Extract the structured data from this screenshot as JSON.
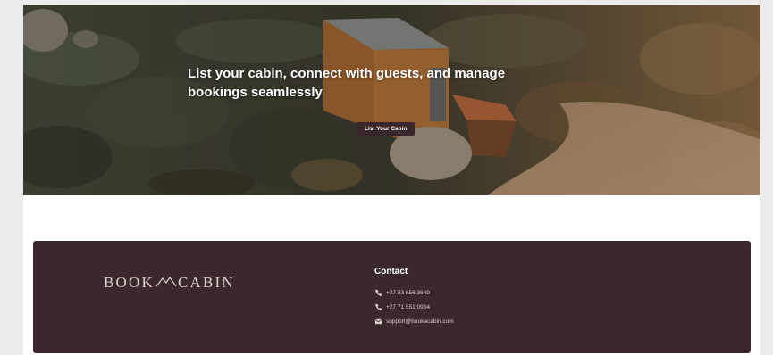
{
  "hero": {
    "headline": "List your cabin, connect with guests, and manage bookings seamlessly",
    "cta_label": "List Your Cabin"
  },
  "footer": {
    "logo": {
      "left": "BOOK",
      "right": "CABIN",
      "icon": "mountain-icon"
    },
    "contact": {
      "title": "Contact",
      "items": [
        {
          "icon": "phone-icon",
          "text": "+27 83 656 3649"
        },
        {
          "icon": "phone-icon",
          "text": "+27 71 551 0934"
        },
        {
          "icon": "mail-icon",
          "text": "support@bookacabin.com"
        }
      ]
    }
  },
  "colors": {
    "footer_bg": "#3b282c",
    "cta_bg": "#3a272b",
    "page_bg": "#ebebeb"
  }
}
